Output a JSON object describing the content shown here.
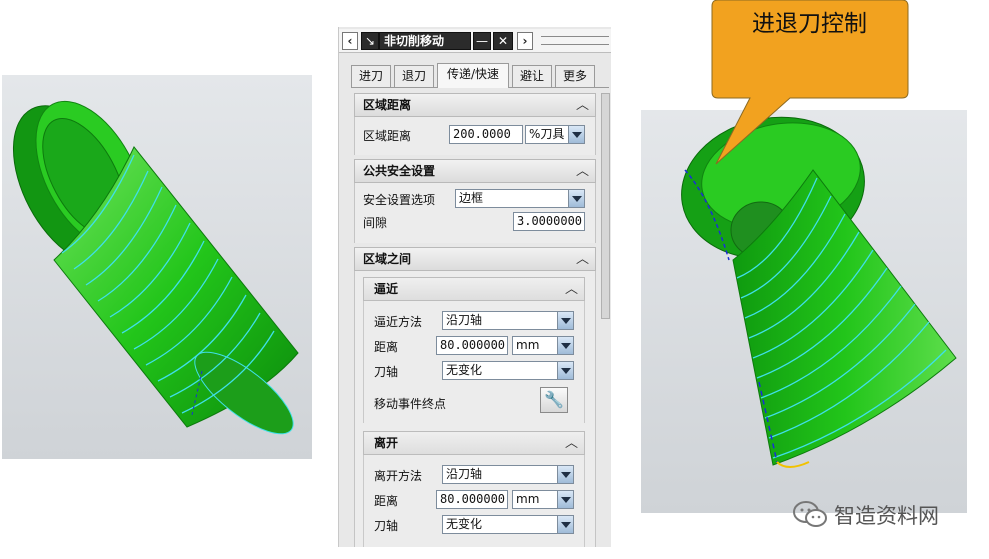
{
  "callout": {
    "text": "进退刀控制",
    "color": "#f2a21f"
  },
  "titlebar": {
    "title": "非切削移动",
    "prev_icon": "chevron-left-icon",
    "pin_icon": "pin-icon",
    "minimize_label": "—",
    "close_label": "✕",
    "next_icon": "chevron-right-icon"
  },
  "tabs": [
    {
      "label": "进刀"
    },
    {
      "label": "退刀"
    },
    {
      "label": "传递/快速",
      "active": true
    },
    {
      "label": "避让"
    },
    {
      "label": "更多"
    }
  ],
  "region_distance": {
    "header": "区域距离",
    "label": "区域距离",
    "value": "200.0000",
    "unit": "%刀具"
  },
  "public_safety": {
    "header": "公共安全设置",
    "option_label": "安全设置选项",
    "option_value": "边框",
    "clearance_label": "间隙",
    "clearance_value": "3.0000000"
  },
  "between_regions": {
    "header": "区域之间",
    "approach": {
      "header": "逼近",
      "method_label": "逼近方法",
      "method_value": "沿刀轴",
      "distance_label": "距离",
      "distance_value": "80.000000",
      "distance_unit": "mm",
      "axis_label": "刀轴",
      "axis_value": "无变化",
      "endpoint_label": "移动事件终点",
      "endpoint_icon": "wrench-icon"
    },
    "depart": {
      "header": "离开",
      "method_label": "离开方法",
      "method_value": "沿刀轴",
      "distance_label": "距离",
      "distance_value": "80.000000",
      "distance_unit": "mm",
      "axis_label": "刀轴",
      "axis_value": "无变化"
    }
  },
  "watermark": {
    "text": "智造资料网",
    "icon": "wechat-icon"
  },
  "colors": {
    "part_green": "#22c51a",
    "toolpath_cyan": "#3fe0e8",
    "rapid_blue": "#1a2fd6",
    "link_yellow": "#f2c200"
  }
}
